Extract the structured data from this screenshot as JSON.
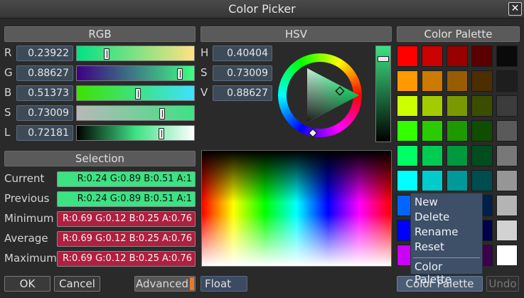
{
  "window": {
    "title": "Color Picker",
    "close_symbol": "✕"
  },
  "rgb": {
    "header": "RGB",
    "rows": [
      {
        "label": "R",
        "value": "0.23922",
        "level": 0.23922
      },
      {
        "label": "G",
        "value": "0.88627",
        "level": 0.88627
      },
      {
        "label": "B",
        "value": "0.51373",
        "level": 0.51373
      },
      {
        "label": "S",
        "value": "0.73009",
        "level": 0.73009
      },
      {
        "label": "L",
        "value": "0.72181",
        "level": 0.72181
      }
    ]
  },
  "hsv": {
    "header": "HSV",
    "rows": [
      {
        "label": "H",
        "value": "0.40404"
      },
      {
        "label": "S",
        "value": "0.73009"
      },
      {
        "label": "V",
        "value": "0.88627"
      }
    ],
    "value_level": 0.88627
  },
  "selection": {
    "header": "Selection",
    "rows": [
      {
        "label": "Current",
        "value": "R:0.24 G:0.89 B:0.51 A:1",
        "color": "#3de283"
      },
      {
        "label": "Previous",
        "value": "R:0.24 G:0.89 B:0.51 A:1",
        "color": "#3de283"
      },
      {
        "label": "Minimum",
        "value": "R:0.69 G:0.12 B:0.25 A:0.76",
        "color": "#b01f40"
      },
      {
        "label": "Average",
        "value": "R:0.69 G:0.12 B:0.25 A:0.76",
        "color": "#b01f40"
      },
      {
        "label": "Maximum",
        "value": "R:0.69 G:0.12 B:0.25 A:0.76",
        "color": "#b01f40"
      }
    ]
  },
  "palette": {
    "header": "Color Palette",
    "rows": [
      [
        "#ff0000",
        "#cc0000",
        "#990000",
        "#5a0000",
        "#0a0a0a"
      ],
      [
        "#ff9900",
        "#cc7a00",
        "#995c00",
        "#4d2e00",
        "#1e1e1e"
      ],
      [
        "#ccff00",
        "#a3cc00",
        "#7a9900",
        "#3d4d00",
        "#3c3c3c"
      ],
      [
        "#33ff00",
        "#29cc00",
        "#1f9900",
        "#0f4d00",
        "#5a5a5a"
      ],
      [
        "#00ff66",
        "#00cc52",
        "#00993d",
        "#004d1f",
        "#787878"
      ],
      [
        "#00ffff",
        "#00cccc",
        "#009999",
        "#004d4d",
        "#969696"
      ],
      [
        "#0066ff",
        "#0052cc",
        "#003d99",
        "#001f4d",
        "#b4b4b4"
      ],
      [
        "#0000ff",
        "#0000cc",
        "#000099",
        "#00004d",
        "#d2d2d2"
      ],
      [
        "#cc00ff",
        "#a300cc",
        "#7a0099",
        "#3d004d",
        "#ffffff"
      ]
    ]
  },
  "context_menu": {
    "items": [
      "New",
      "Delete",
      "Rename",
      "Reset"
    ],
    "footer": "Color Palette"
  },
  "buttons": {
    "ok": "OK",
    "cancel": "Cancel",
    "advanced": "Advanced",
    "float": "Float",
    "palette_select": "Color Palette",
    "undo": "Undo"
  }
}
